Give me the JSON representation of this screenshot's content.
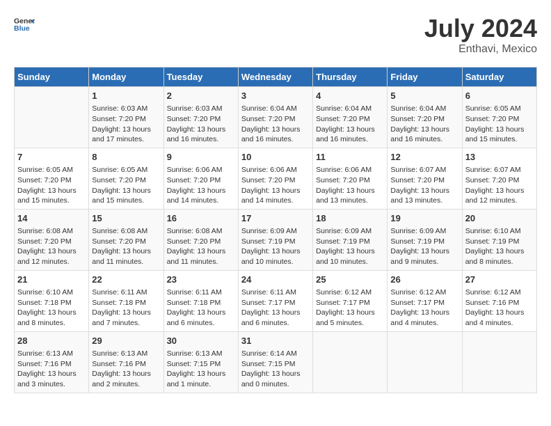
{
  "header": {
    "logo_general": "General",
    "logo_blue": "Blue",
    "title": "July 2024",
    "subtitle": "Enthavi, Mexico"
  },
  "days_of_week": [
    "Sunday",
    "Monday",
    "Tuesday",
    "Wednesday",
    "Thursday",
    "Friday",
    "Saturday"
  ],
  "weeks": [
    [
      {
        "day": "",
        "info": ""
      },
      {
        "day": "1",
        "info": "Sunrise: 6:03 AM\nSunset: 7:20 PM\nDaylight: 13 hours\nand 17 minutes."
      },
      {
        "day": "2",
        "info": "Sunrise: 6:03 AM\nSunset: 7:20 PM\nDaylight: 13 hours\nand 16 minutes."
      },
      {
        "day": "3",
        "info": "Sunrise: 6:04 AM\nSunset: 7:20 PM\nDaylight: 13 hours\nand 16 minutes."
      },
      {
        "day": "4",
        "info": "Sunrise: 6:04 AM\nSunset: 7:20 PM\nDaylight: 13 hours\nand 16 minutes."
      },
      {
        "day": "5",
        "info": "Sunrise: 6:04 AM\nSunset: 7:20 PM\nDaylight: 13 hours\nand 16 minutes."
      },
      {
        "day": "6",
        "info": "Sunrise: 6:05 AM\nSunset: 7:20 PM\nDaylight: 13 hours\nand 15 minutes."
      }
    ],
    [
      {
        "day": "7",
        "info": "Sunrise: 6:05 AM\nSunset: 7:20 PM\nDaylight: 13 hours\nand 15 minutes."
      },
      {
        "day": "8",
        "info": "Sunrise: 6:05 AM\nSunset: 7:20 PM\nDaylight: 13 hours\nand 15 minutes."
      },
      {
        "day": "9",
        "info": "Sunrise: 6:06 AM\nSunset: 7:20 PM\nDaylight: 13 hours\nand 14 minutes."
      },
      {
        "day": "10",
        "info": "Sunrise: 6:06 AM\nSunset: 7:20 PM\nDaylight: 13 hours\nand 14 minutes."
      },
      {
        "day": "11",
        "info": "Sunrise: 6:06 AM\nSunset: 7:20 PM\nDaylight: 13 hours\nand 13 minutes."
      },
      {
        "day": "12",
        "info": "Sunrise: 6:07 AM\nSunset: 7:20 PM\nDaylight: 13 hours\nand 13 minutes."
      },
      {
        "day": "13",
        "info": "Sunrise: 6:07 AM\nSunset: 7:20 PM\nDaylight: 13 hours\nand 12 minutes."
      }
    ],
    [
      {
        "day": "14",
        "info": "Sunrise: 6:08 AM\nSunset: 7:20 PM\nDaylight: 13 hours\nand 12 minutes."
      },
      {
        "day": "15",
        "info": "Sunrise: 6:08 AM\nSunset: 7:20 PM\nDaylight: 13 hours\nand 11 minutes."
      },
      {
        "day": "16",
        "info": "Sunrise: 6:08 AM\nSunset: 7:20 PM\nDaylight: 13 hours\nand 11 minutes."
      },
      {
        "day": "17",
        "info": "Sunrise: 6:09 AM\nSunset: 7:19 PM\nDaylight: 13 hours\nand 10 minutes."
      },
      {
        "day": "18",
        "info": "Sunrise: 6:09 AM\nSunset: 7:19 PM\nDaylight: 13 hours\nand 10 minutes."
      },
      {
        "day": "19",
        "info": "Sunrise: 6:09 AM\nSunset: 7:19 PM\nDaylight: 13 hours\nand 9 minutes."
      },
      {
        "day": "20",
        "info": "Sunrise: 6:10 AM\nSunset: 7:19 PM\nDaylight: 13 hours\nand 8 minutes."
      }
    ],
    [
      {
        "day": "21",
        "info": "Sunrise: 6:10 AM\nSunset: 7:18 PM\nDaylight: 13 hours\nand 8 minutes."
      },
      {
        "day": "22",
        "info": "Sunrise: 6:11 AM\nSunset: 7:18 PM\nDaylight: 13 hours\nand 7 minutes."
      },
      {
        "day": "23",
        "info": "Sunrise: 6:11 AM\nSunset: 7:18 PM\nDaylight: 13 hours\nand 6 minutes."
      },
      {
        "day": "24",
        "info": "Sunrise: 6:11 AM\nSunset: 7:17 PM\nDaylight: 13 hours\nand 6 minutes."
      },
      {
        "day": "25",
        "info": "Sunrise: 6:12 AM\nSunset: 7:17 PM\nDaylight: 13 hours\nand 5 minutes."
      },
      {
        "day": "26",
        "info": "Sunrise: 6:12 AM\nSunset: 7:17 PM\nDaylight: 13 hours\nand 4 minutes."
      },
      {
        "day": "27",
        "info": "Sunrise: 6:12 AM\nSunset: 7:16 PM\nDaylight: 13 hours\nand 4 minutes."
      }
    ],
    [
      {
        "day": "28",
        "info": "Sunrise: 6:13 AM\nSunset: 7:16 PM\nDaylight: 13 hours\nand 3 minutes."
      },
      {
        "day": "29",
        "info": "Sunrise: 6:13 AM\nSunset: 7:16 PM\nDaylight: 13 hours\nand 2 minutes."
      },
      {
        "day": "30",
        "info": "Sunrise: 6:13 AM\nSunset: 7:15 PM\nDaylight: 13 hours\nand 1 minute."
      },
      {
        "day": "31",
        "info": "Sunrise: 6:14 AM\nSunset: 7:15 PM\nDaylight: 13 hours\nand 0 minutes."
      },
      {
        "day": "",
        "info": ""
      },
      {
        "day": "",
        "info": ""
      },
      {
        "day": "",
        "info": ""
      }
    ]
  ]
}
